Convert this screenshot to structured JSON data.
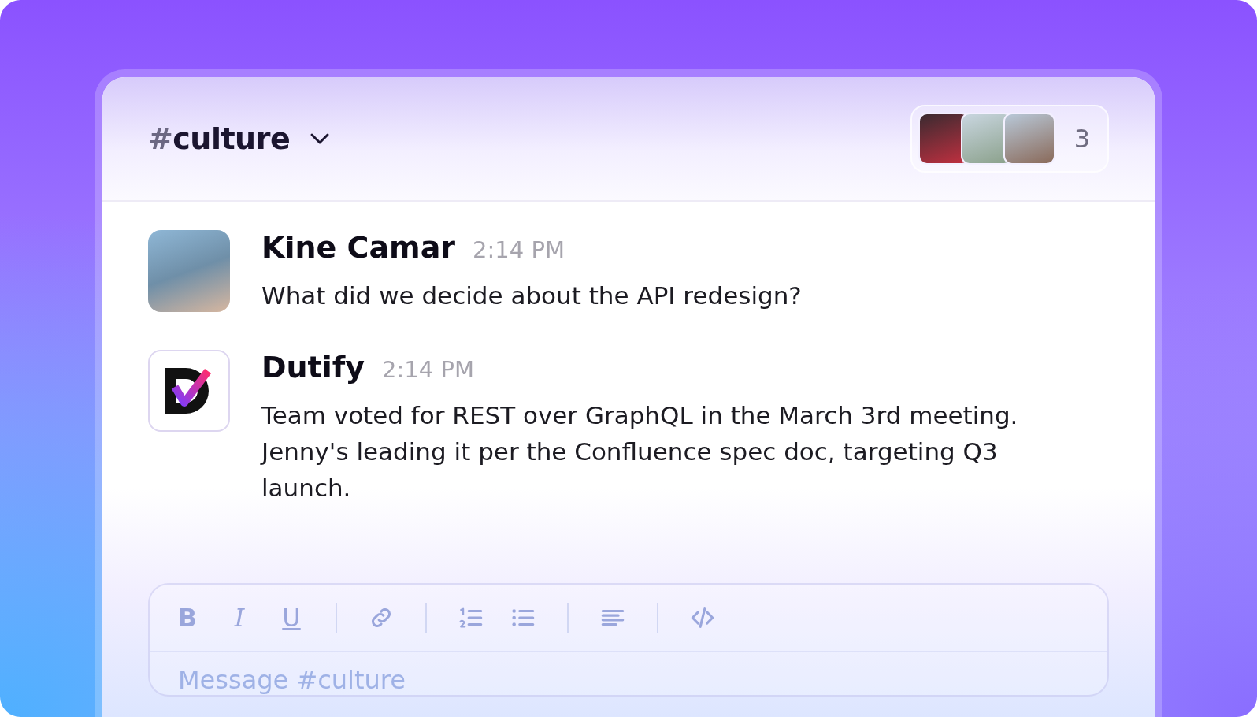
{
  "channel": {
    "name": "#culture"
  },
  "members": {
    "avatars": [
      {
        "kind": "photo"
      },
      {
        "kind": "photo"
      },
      {
        "kind": "photo"
      }
    ],
    "count": "3"
  },
  "messages": [
    {
      "author": "Kine Camar",
      "time": "2:14 PM",
      "text": "What did we decide about the API redesign?",
      "kind": "user"
    },
    {
      "author": "Dutify",
      "time": "2:14 PM",
      "text": "Team voted for REST over GraphQL in the March 3rd meeting. Jenny's leading it per the Confluence spec doc, targeting Q3 launch.",
      "kind": "bot"
    }
  ],
  "composer": {
    "toolbar": [
      {
        "kind": "bold",
        "label": "B"
      },
      {
        "kind": "italic",
        "label": "I"
      },
      {
        "kind": "underline",
        "label": "U"
      },
      {
        "kind": "separator"
      },
      {
        "kind": "link"
      },
      {
        "kind": "separator"
      },
      {
        "kind": "ordered_list"
      },
      {
        "kind": "bullet_list"
      },
      {
        "kind": "separator"
      },
      {
        "kind": "align"
      },
      {
        "kind": "separator"
      },
      {
        "kind": "code"
      }
    ],
    "placeholder": "Message #culture"
  }
}
